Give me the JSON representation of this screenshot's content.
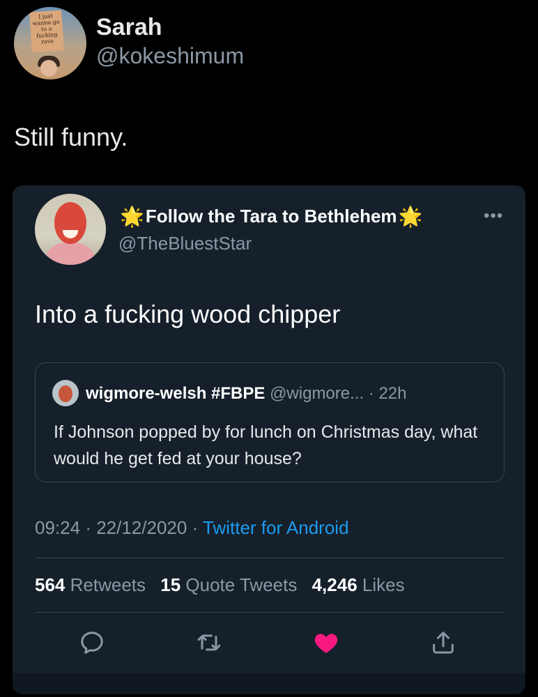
{
  "outer_tweet": {
    "display_name": "Sarah",
    "handle": "@kokeshimum",
    "text": "Still funny.",
    "avatar_sign_text": "I just wanna go to a fucking rave"
  },
  "embedded_tweet": {
    "display_name": "Follow the Tara to Bethlehem",
    "name_emoji": "🌟",
    "handle": "@TheBluestStar",
    "more_label": "•••",
    "text": "Into a fucking wood chipper",
    "quoted": {
      "display_name": "wigmore-welsh #FBPE",
      "meta": "@wigmore... · 22h",
      "text": "If Johnson popped by for lunch on  Christmas day, what would he get fed at your house?"
    },
    "time": "09:24",
    "date": "22/12/2020",
    "source": "Twitter for Android",
    "stats": {
      "retweets_count": "564",
      "retweets_label": "Retweets",
      "quotes_count": "15",
      "quotes_label": "Quote Tweets",
      "likes_count": "4,246",
      "likes_label": "Likes"
    },
    "actions": [
      "reply-icon",
      "retweet-icon",
      "like-icon",
      "share-icon"
    ],
    "like_color": "#f91880"
  },
  "colors": {
    "background": "#000000",
    "card": "#15202b",
    "accent": "#1d9bf0",
    "muted": "#8b98a5",
    "border": "#38444d"
  }
}
